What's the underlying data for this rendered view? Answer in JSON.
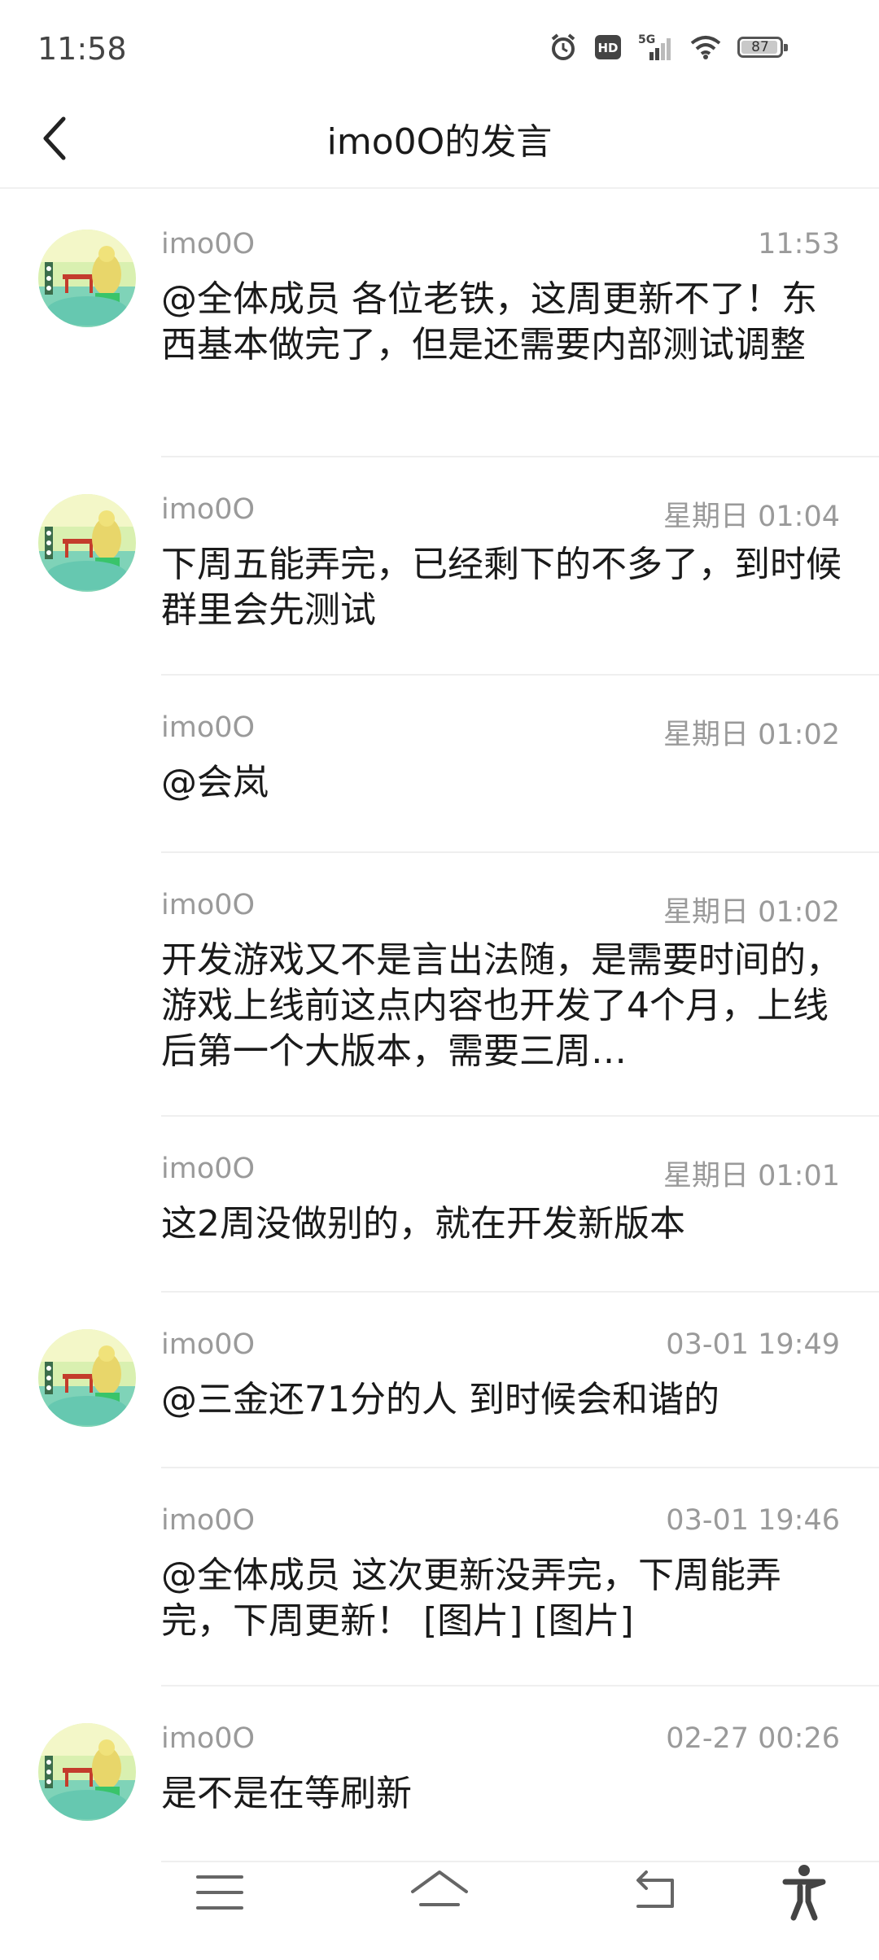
{
  "status_bar": {
    "time": "11:58",
    "icons": [
      "alarm-icon",
      "hd-icon",
      "5g-signal-icon",
      "wifi-icon"
    ],
    "network": "5G",
    "battery": {
      "percent": 87,
      "label": "87"
    }
  },
  "header": {
    "title": "imo0O的发言",
    "back_icon": "chevron-left-icon"
  },
  "colors": {
    "accent_text": "#1a1a1a",
    "secondary_text": "#9a9a9a",
    "divider": "#efefef"
  },
  "messages": [
    {
      "author": "imo0O",
      "time": "11:53",
      "text": "@全体成员 各位老铁，这周更新不了！东西基本做完了，但是还需要内部测试调整",
      "has_avatar": true
    },
    {
      "author": "imo0O",
      "time": "星期日 01:04",
      "text": "下周五能弄完，已经剩下的不多了，到时候群里会先测试",
      "has_avatar": true
    },
    {
      "author": "imo0O",
      "time": "星期日 01:02",
      "text": "@会岚",
      "has_avatar": false
    },
    {
      "author": "imo0O",
      "time": "星期日 01:02",
      "text": "开发游戏又不是言出法随，是需要时间的，游戏上线前这点内容也开发了4个月，上线后第一个大版本，需要三周…",
      "has_avatar": false
    },
    {
      "author": "imo0O",
      "time": "星期日 01:01",
      "text": "这2周没做别的，就在开发新版本",
      "has_avatar": false
    },
    {
      "author": "imo0O",
      "time": "03-01 19:49",
      "text": "@三金还71分的人 到时候会和谐的",
      "has_avatar": true
    },
    {
      "author": "imo0O",
      "time": "03-01 19:46",
      "text": "@全体成员 这次更新没弄完，下周能弄完，下周更新！ [图片] [图片]",
      "has_avatar": false
    },
    {
      "author": "imo0O",
      "time": "02-27 00:26",
      "text": "是不是在等刷新",
      "has_avatar": true
    }
  ],
  "nav_bar": {
    "items": [
      "menu-icon",
      "home-icon",
      "back-icon",
      "accessibility-icon"
    ]
  }
}
